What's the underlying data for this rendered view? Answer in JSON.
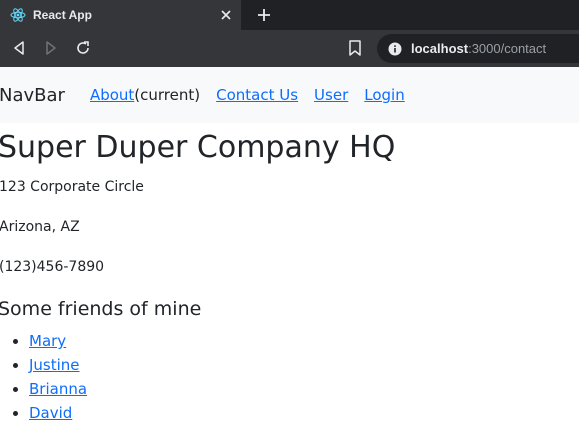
{
  "browser": {
    "tab_title": "React App",
    "url_host": "localhost",
    "url_rest": ":3000/contact"
  },
  "navbar": {
    "brand": "NavBar",
    "links": {
      "about": "About",
      "current": "(current)",
      "contact": "Contact Us",
      "user": "User",
      "login": "Login"
    }
  },
  "main": {
    "title": "Super Duper Company HQ",
    "address_line1": "123 Corporate Circle",
    "address_line2": "Arizona, AZ",
    "phone": "(123)456-7890",
    "friends_heading": "Some friends of mine",
    "friends": [
      "Mary",
      "Justine",
      "Brianna",
      "David"
    ]
  },
  "colors": {
    "link": "#0d6efd",
    "navbar_bg": "#f8f9fa",
    "chrome_dark": "#202124",
    "chrome_tab": "#35363a"
  }
}
